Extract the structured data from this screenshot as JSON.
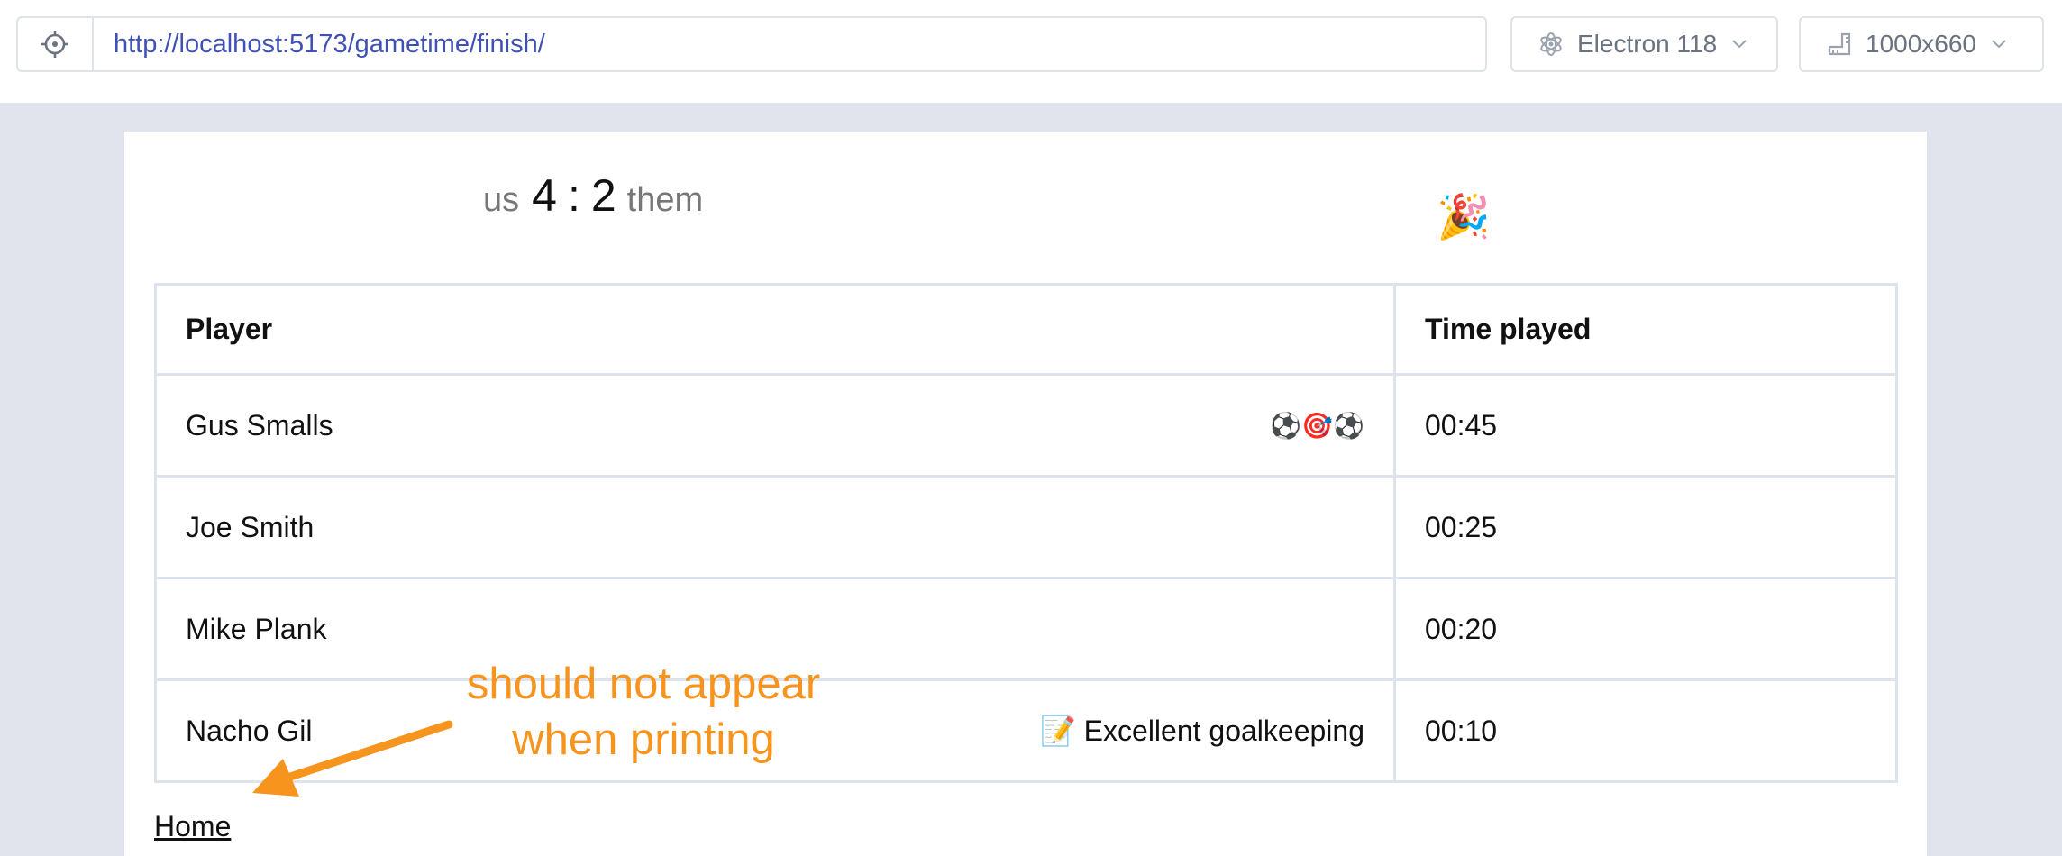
{
  "browser": {
    "url": "http://localhost:5173/gametime/finish/",
    "target_icon": "crosshair-icon",
    "engine_label": "Electron 118",
    "engine_icon": "electron-icon",
    "viewport_label": "1000x660",
    "viewport_icon": "ruler-icon"
  },
  "game": {
    "home_label": "us",
    "home_score": "4",
    "separator": ":",
    "away_score": "2",
    "away_label": "them",
    "celebration_emoji": "🎉"
  },
  "table": {
    "headers": [
      "Player",
      "Time played"
    ],
    "rows": [
      {
        "player": "Gus Smalls",
        "marks": "⚽🎯⚽",
        "time": "00:45"
      },
      {
        "player": "Joe Smith",
        "marks": "",
        "time": "00:25"
      },
      {
        "player": "Mike Plank",
        "marks": "",
        "time": "00:20"
      },
      {
        "player": "Nacho Gil",
        "marks": "📝 Excellent goalkeeping",
        "time": "00:10"
      }
    ]
  },
  "links": {
    "home": "Home"
  },
  "annotation": {
    "line1": "should not appear",
    "line2": "when printing",
    "color": "#f7941d"
  }
}
